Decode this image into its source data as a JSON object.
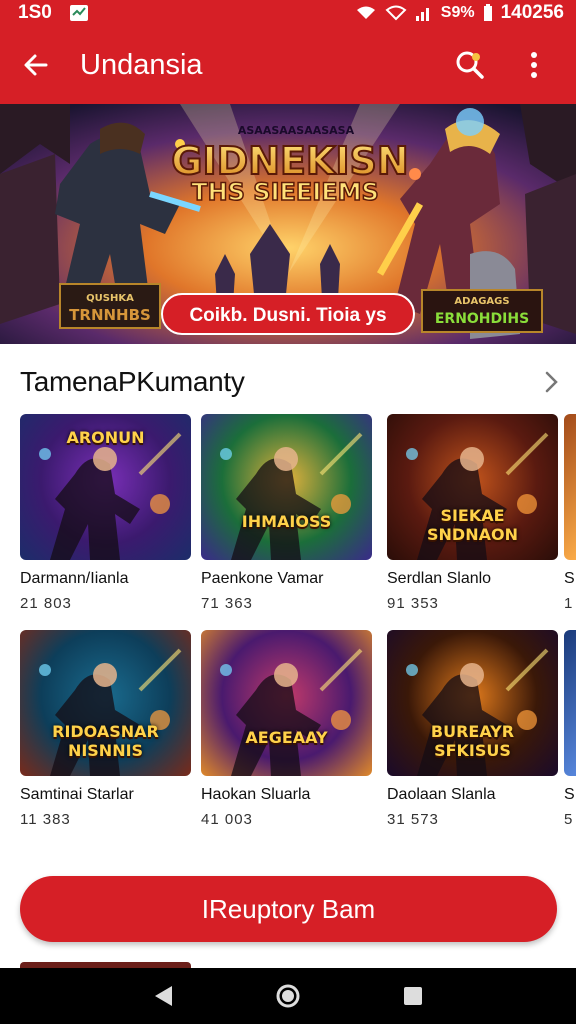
{
  "status_bar": {
    "time_left": "1S0",
    "battery": " S9%",
    "clock": "140256"
  },
  "app_bar": {
    "title": "Undansia",
    "back_icon": "arrow-left-icon",
    "search_icon": "search-gear-icon",
    "menu_icon": "more-vertical-icon"
  },
  "banner": {
    "headline_small": "ASAASAASAASASA",
    "headline_1": "GIDNEKISN",
    "headline_2": "THS SIEEIEMS",
    "pill": "Coikb. Dusni. Tioia ys",
    "left_badge_1": "QUSHKA",
    "left_badge_2": "TRNNHBS",
    "right_badge_1": "ADAGAGS",
    "right_badge_2": "ERNOHDIHS"
  },
  "section": {
    "title": "TamenaPKumanty"
  },
  "cards": [
    {
      "name": "Darmann/Iianla",
      "meta": "21 803",
      "art": "ARONUN",
      "palette": [
        "#3b1a6e",
        "#7a2fb8",
        "#1c2d6a"
      ]
    },
    {
      "name": "Paenkone Vamar",
      "meta": "71 363",
      "art": "IHMAIOSS",
      "palette": [
        "#1b6e3a",
        "#e3b23c",
        "#3a2a8a"
      ]
    },
    {
      "name": "Serdlan Slanlo",
      "meta": "91 353",
      "art": "SIEKAE SNDNAON",
      "palette": [
        "#5a1a10",
        "#c2541c",
        "#2a0d08"
      ]
    },
    {
      "name": "Samtinai Starlar",
      "meta": "11 383",
      "art": "RIDOASNAR NISNNIS",
      "palette": [
        "#0d3e5a",
        "#1a6b8e",
        "#7a2a1a"
      ]
    },
    {
      "name": "Haokan Sluarla",
      "meta": "41 003",
      "art": "AEGEAAY",
      "palette": [
        "#4a1a6e",
        "#c23a6a",
        "#e08a2a"
      ]
    },
    {
      "name": "Daolaan Slanla",
      "meta": "31 573",
      "art": "BUREAYR SFKISUS",
      "palette": [
        "#3a1808",
        "#e07a1c",
        "#1a0a2a"
      ]
    }
  ],
  "cta": {
    "label": "IReuptory Bam"
  },
  "nav": {
    "back": "triangle-back-icon",
    "home": "circle-home-icon",
    "recents": "square-recents-icon"
  },
  "colors": {
    "accent": "#d61f26",
    "nav": "#000000"
  }
}
